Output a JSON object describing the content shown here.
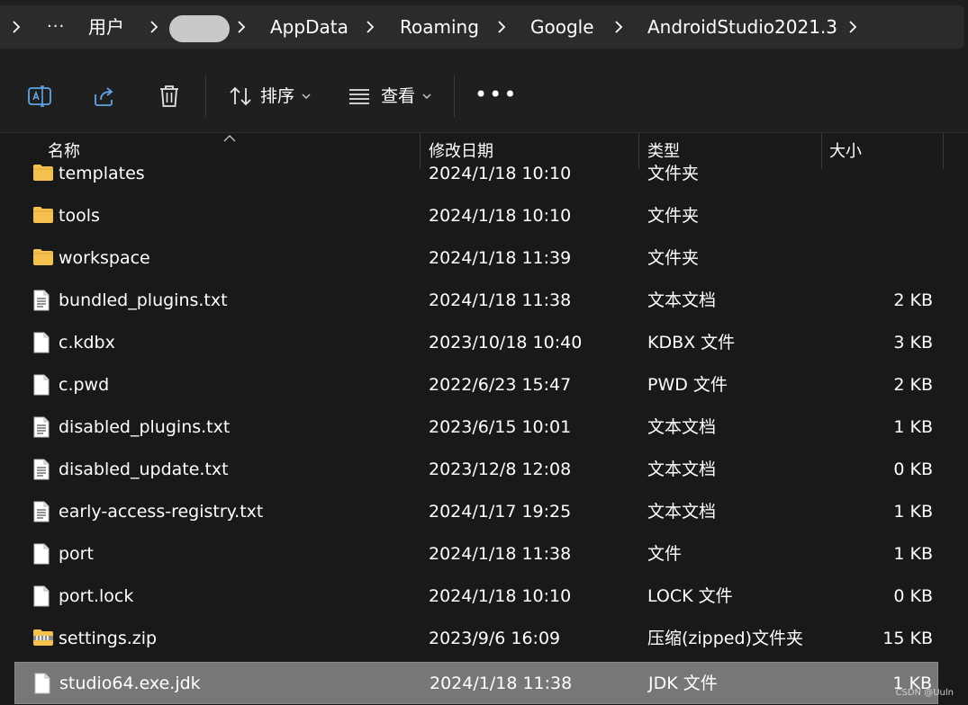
{
  "breadcrumb": {
    "more_label": "···",
    "items": [
      "用户",
      "AppData",
      "Roaming",
      "Google",
      "AndroidStudio2021.3"
    ]
  },
  "toolbar": {
    "sort_label": "排序",
    "view_label": "查看",
    "more_label": "•••"
  },
  "columns": {
    "name": "名称",
    "date": "修改日期",
    "type": "类型",
    "size": "大小"
  },
  "files": [
    {
      "name": "templates",
      "date": "2024/1/18 10:10",
      "type": "文件夹",
      "size": "",
      "icon": "folder"
    },
    {
      "name": "tools",
      "date": "2024/1/18 10:10",
      "type": "文件夹",
      "size": "",
      "icon": "folder"
    },
    {
      "name": "workspace",
      "date": "2024/1/18 11:39",
      "type": "文件夹",
      "size": "",
      "icon": "folder"
    },
    {
      "name": "bundled_plugins.txt",
      "date": "2024/1/18 11:38",
      "type": "文本文档",
      "size": "2 KB",
      "icon": "text"
    },
    {
      "name": "c.kdbx",
      "date": "2023/10/18 10:40",
      "type": "KDBX 文件",
      "size": "3 KB",
      "icon": "file"
    },
    {
      "name": "c.pwd",
      "date": "2022/6/23 15:47",
      "type": "PWD 文件",
      "size": "2 KB",
      "icon": "file"
    },
    {
      "name": "disabled_plugins.txt",
      "date": "2023/6/15 10:01",
      "type": "文本文档",
      "size": "1 KB",
      "icon": "text"
    },
    {
      "name": "disabled_update.txt",
      "date": "2023/12/8 12:08",
      "type": "文本文档",
      "size": "0 KB",
      "icon": "text"
    },
    {
      "name": "early-access-registry.txt",
      "date": "2024/1/17 19:25",
      "type": "文本文档",
      "size": "1 KB",
      "icon": "text"
    },
    {
      "name": "port",
      "date": "2024/1/18 11:38",
      "type": "文件",
      "size": "1 KB",
      "icon": "file"
    },
    {
      "name": "port.lock",
      "date": "2024/1/18 10:10",
      "type": "LOCK 文件",
      "size": "0 KB",
      "icon": "file"
    },
    {
      "name": "settings.zip",
      "date": "2023/9/6 16:09",
      "type": "压缩(zipped)文件夹",
      "size": "15 KB",
      "icon": "zip"
    },
    {
      "name": "studio64.exe.jdk",
      "date": "2024/1/18 11:38",
      "type": "JDK 文件",
      "size": "1 KB",
      "icon": "file",
      "selected": true
    }
  ],
  "watermark": "CSDN @Uuln",
  "colors": {
    "background": "#191919",
    "crumb_bg": "#2b2b2b",
    "selection": "#777777",
    "folder": "#f4c04e"
  }
}
